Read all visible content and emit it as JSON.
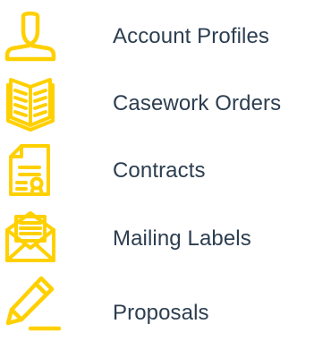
{
  "colors": {
    "icon": "#ffd000",
    "label_text": "#2c3e50",
    "background": "#ffffff"
  },
  "menu": {
    "items": [
      {
        "label": "Account Profiles",
        "icon": "user-profile-icon"
      },
      {
        "label": "Casework Orders",
        "icon": "open-book-icon"
      },
      {
        "label": "Contracts",
        "icon": "contract-document-icon"
      },
      {
        "label": "Mailing Labels",
        "icon": "open-envelope-letter-icon"
      },
      {
        "label": "Proposals",
        "icon": "pencil-icon"
      }
    ]
  }
}
